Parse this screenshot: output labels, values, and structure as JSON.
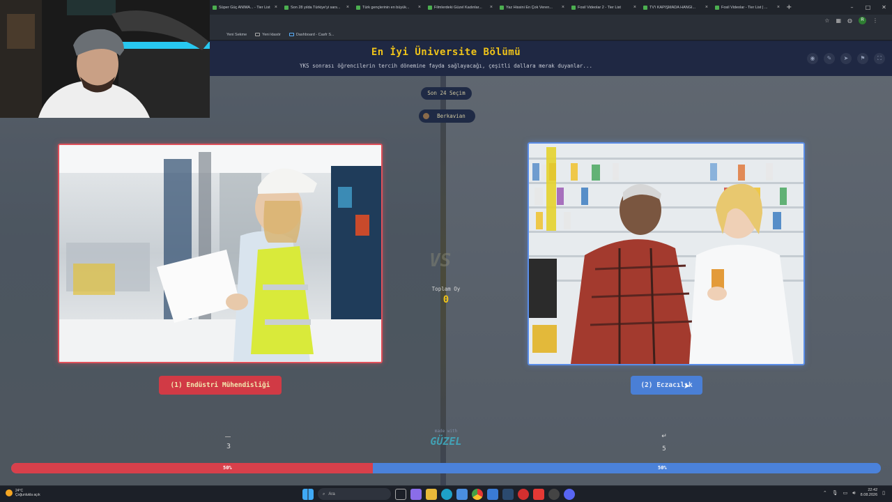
{
  "browser": {
    "tabs": [
      {
        "label": "Süper Güç ANİMA... - Tier List"
      },
      {
        "label": "Son 28 yılda Türkiye'yi sars..."
      },
      {
        "label": "Türk gençlerinin en büyük..."
      },
      {
        "label": "Filmlerdeki Güzel Kadınlar..."
      },
      {
        "label": "Yaz Hissini En Çok Veren..."
      },
      {
        "label": "Fosil Videolar 2 - Tier List"
      },
      {
        "label": "TV'i KAPIŞMADA HANGİ..."
      },
      {
        "label": "Fosil Videolar - Tier List | ..."
      }
    ],
    "new_tab": "+",
    "bookmarks": [
      {
        "label": "Yeni Sekme"
      },
      {
        "label": "Yeni klasör"
      },
      {
        "label": "Dashboard - Casfr S..."
      }
    ],
    "profile_initial": "R"
  },
  "page": {
    "title": "En İyi Üniversite Bölümü",
    "subtitle": "YKS sonrası öğrencilerin tercih dönemine fayda sağlayacağı, çeşitli dallara merak duyanlar...",
    "round_label": "Son 24 Seçim",
    "username": "Berkavian",
    "vs_text": "VS",
    "total_votes_label": "Toplam Oy",
    "total_votes": "0",
    "option_left": {
      "label": "(1) Endüstri Mühendisliği",
      "color": "#d13a45",
      "percent_label": "50%",
      "votes_value": "3",
      "share": 0.5
    },
    "option_right": {
      "label": "(2) Eczacılık",
      "color": "#4a7fd6",
      "percent_label": "50%",
      "arrow": "↵",
      "key_hint": "5",
      "share": 0.5
    },
    "brand_small": "made with",
    "brand": "GÜZEL"
  },
  "taskbar": {
    "weather_temp": "24°C",
    "weather_desc": "Çoğunlukla açık",
    "search_placeholder": "Ara",
    "time": "22:42",
    "date": "8.08.2026"
  },
  "colors": {
    "accent": "#f0c419",
    "left": "#d13a45",
    "right": "#4a7fd6"
  }
}
